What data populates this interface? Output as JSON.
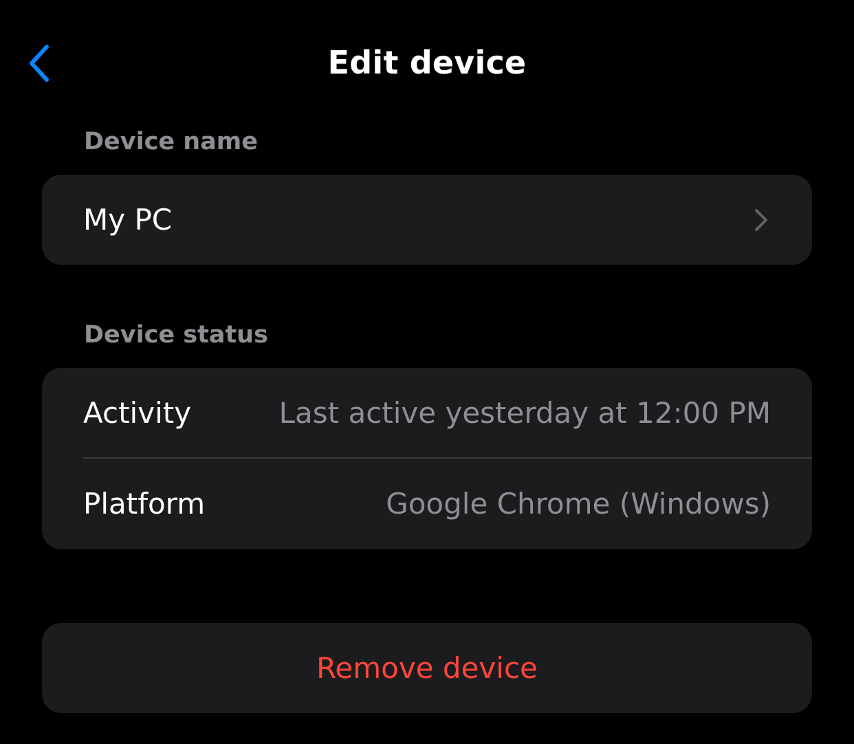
{
  "colors": {
    "background": "#000000",
    "card": "#1c1c1e",
    "accent": "#0a84ff",
    "secondary_text": "#8e8e93",
    "destructive": "#ff453a",
    "separator": "#3a3a3c"
  },
  "nav": {
    "back_icon": "chevron-left-icon",
    "title": "Edit device"
  },
  "device_name_section": {
    "label": "Device name",
    "value": "My PC",
    "chevron_icon": "chevron-right-icon"
  },
  "device_status_section": {
    "label": "Device status",
    "rows": [
      {
        "label": "Activity",
        "value": "Last active yesterday at 12:00 PM"
      },
      {
        "label": "Platform",
        "value": "Google Chrome (Windows)"
      }
    ]
  },
  "actions": {
    "remove_label": "Remove device"
  }
}
